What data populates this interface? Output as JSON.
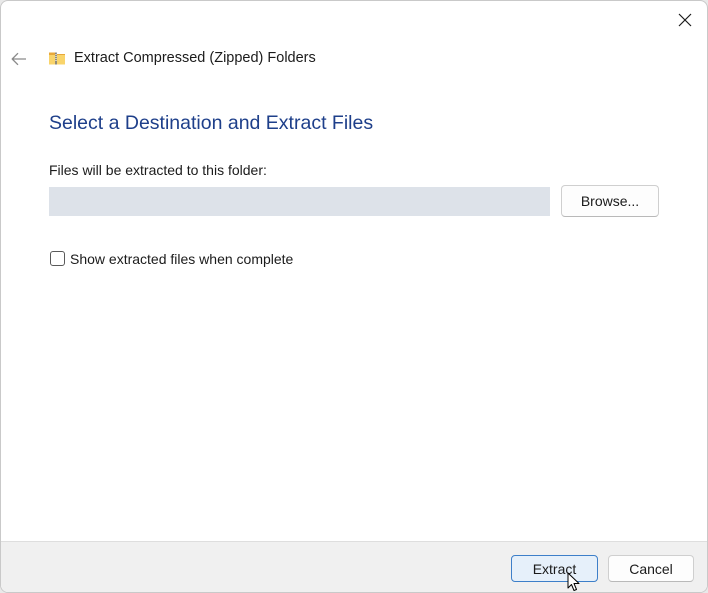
{
  "window": {
    "title": "Extract Compressed (Zipped) Folders",
    "title_icon": "zip-folder-icon",
    "close_icon": "close-icon",
    "back_icon": "back-arrow-icon"
  },
  "main": {
    "heading": "Select a Destination and Extract Files",
    "folder_label": "Files will be extracted to this folder:",
    "path_value": "",
    "browse_label": "Browse...",
    "show_files_label": "Show extracted files when complete",
    "show_files_checked": false
  },
  "footer": {
    "extract_label": "Extract",
    "cancel_label": "Cancel"
  },
  "colors": {
    "heading": "#1e3f8a",
    "accent_border": "#3d7fc9",
    "input_background": "#dde2e9",
    "footer_background": "#f0f0f0"
  }
}
